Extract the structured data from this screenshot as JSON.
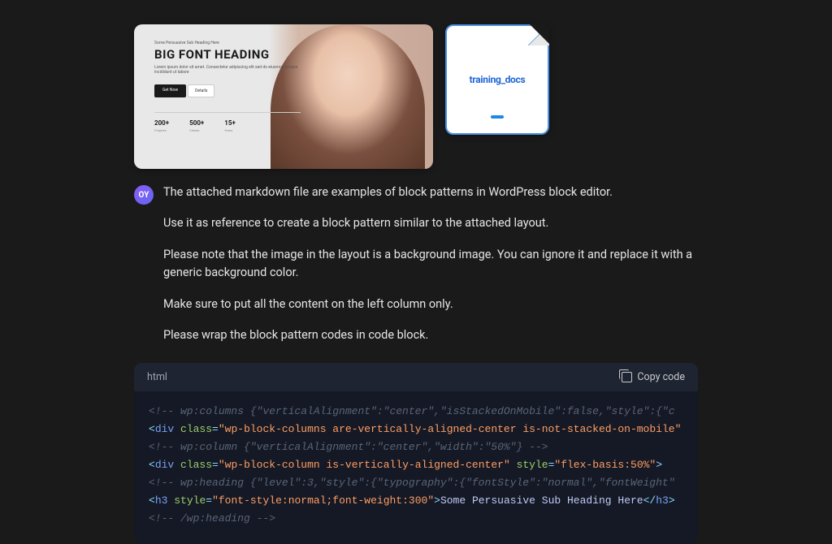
{
  "attachments": {
    "image_preview": {
      "sub_heading": "Some Persuasive Sub Heading Here",
      "heading": "BIG FONT HEADING",
      "description": "Lorem ipsum dolor sit amet. Consectetur adipiscing elit sed do eiusmod tempor incididunt ut labore",
      "btn_primary": "Get Now",
      "btn_secondary": "Details",
      "stats": [
        {
          "value": "200+",
          "label": "Projects"
        },
        {
          "value": "500+",
          "label": "Clients"
        },
        {
          "value": "15+",
          "label": "Years"
        }
      ]
    },
    "file": {
      "name": "training_docs"
    }
  },
  "user": {
    "initials": "OY"
  },
  "message": {
    "p1": "The attached markdown file are examples of block patterns in WordPress block editor.",
    "p2": "Use it as reference to create a block pattern similar to the attached layout.",
    "p3": "Please note that the image in the layout is a background image. You can ignore it and replace it with a generic background color.",
    "p4": "Make sure to put all the content on the left column only.",
    "p5": "Please wrap the block pattern codes in code block."
  },
  "code_block": {
    "language": "html",
    "copy_label": "Copy code",
    "lines": {
      "l1_comment": "<!-- wp:columns {\"verticalAlignment\":\"center\",\"isStackedOnMobile\":false,\"style\":{\"c",
      "l2": {
        "tag": "div",
        "class_attr": "class",
        "class_val": "wp-block-columns are-vertically-aligned-center is-not-stacked-on-mobile"
      },
      "l3_comment": "<!-- wp:column {\"verticalAlignment\":\"center\",\"width\":\"50%\"} -->",
      "l4": {
        "tag": "div",
        "class_attr": "class",
        "class_val": "wp-block-column is-vertically-aligned-center",
        "style_attr": "style",
        "style_val": "flex-basis:50%"
      },
      "l5_comment": "<!-- wp:heading {\"level\":3,\"style\":{\"typography\":{\"fontStyle\":\"normal\",\"fontWeight\"",
      "l6": {
        "tag": "h3",
        "style_attr": "style",
        "style_val": "font-style:normal;font-weight:300",
        "text": "Some Persuasive Sub Heading Here",
        "close_tag": "h3"
      },
      "l7_comment": "<!-- /wp:heading -->"
    }
  }
}
